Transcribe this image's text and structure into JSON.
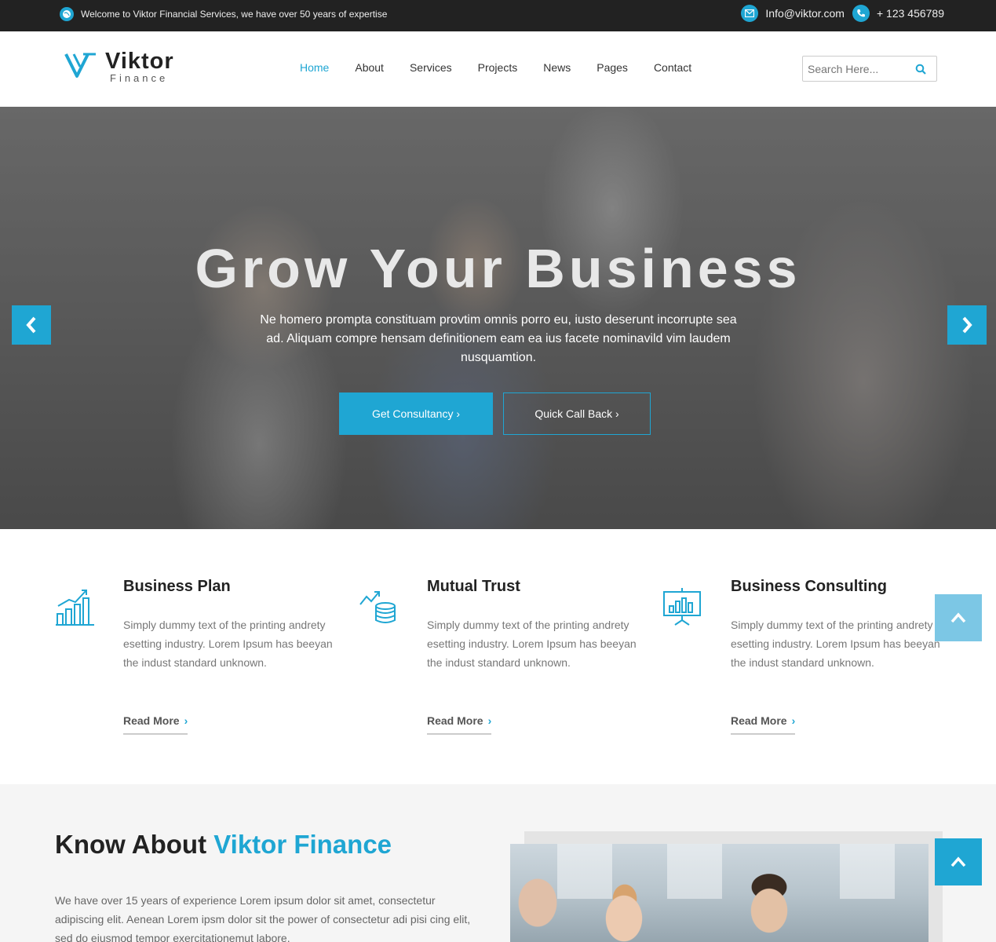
{
  "topbar": {
    "welcome": "Welcome to Viktor Financial Services, we have over 50 years of expertise",
    "email": "Info@viktor.com",
    "phone": "+ 123 456789",
    "icons": [
      "globe-icon",
      "envelope-icon",
      "phone-icon"
    ]
  },
  "header": {
    "logo_name": "Viktor",
    "logo_sub": "Finance",
    "nav": [
      {
        "label": "Home",
        "active": true
      },
      {
        "label": "About"
      },
      {
        "label": "Services"
      },
      {
        "label": "Projects"
      },
      {
        "label": "News"
      },
      {
        "label": "Pages"
      },
      {
        "label": "Contact"
      }
    ],
    "search_placeholder": "Search Here..."
  },
  "hero": {
    "title": "Grow Your Business",
    "description": "Ne homero prompta constituam provtim omnis porro eu, iusto deserunt incorrupte sea ad. Aliquam compre hensam definitionem eam ea ius facete nominavild vim laudem nusquamtion.",
    "btn_primary": "Get Consultancy ›",
    "btn_secondary": "Quick Call Back ›"
  },
  "features": [
    {
      "title": "Business Plan",
      "text": "Simply dummy text of the printing andrety esetting industry. Lorem Ipsum has beeyan the indust standard unknown.",
      "link": "Read More",
      "icon": "growth-chart-icon"
    },
    {
      "title": "Mutual Trust",
      "text": "Simply dummy text of the printing andrety esetting industry. Lorem Ipsum has beeyan the indust standard unknown.",
      "link": "Read More",
      "icon": "coins-growth-icon"
    },
    {
      "title": "Business Consulting",
      "text": "Simply dummy text of the printing andrety esetting industry. Lorem Ipsum has beeyan the indust standard unknown.",
      "link": "Read More",
      "icon": "presentation-board-icon"
    }
  ],
  "about": {
    "title_plain": "Know About ",
    "title_accent": "Viktor Finance",
    "text": "We have over 15 years of experience Lorem ipsum dolor sit amet, consectetur adipiscing elit. Aenean Lorem ipsm dolor sit the power of consectetur adi pisi cing elit, sed do eiusmod tempor exercitationemut labore."
  },
  "colors": {
    "accent": "#1fa6d3",
    "topbar": "#222222",
    "about_bg": "#f5f5f5"
  }
}
